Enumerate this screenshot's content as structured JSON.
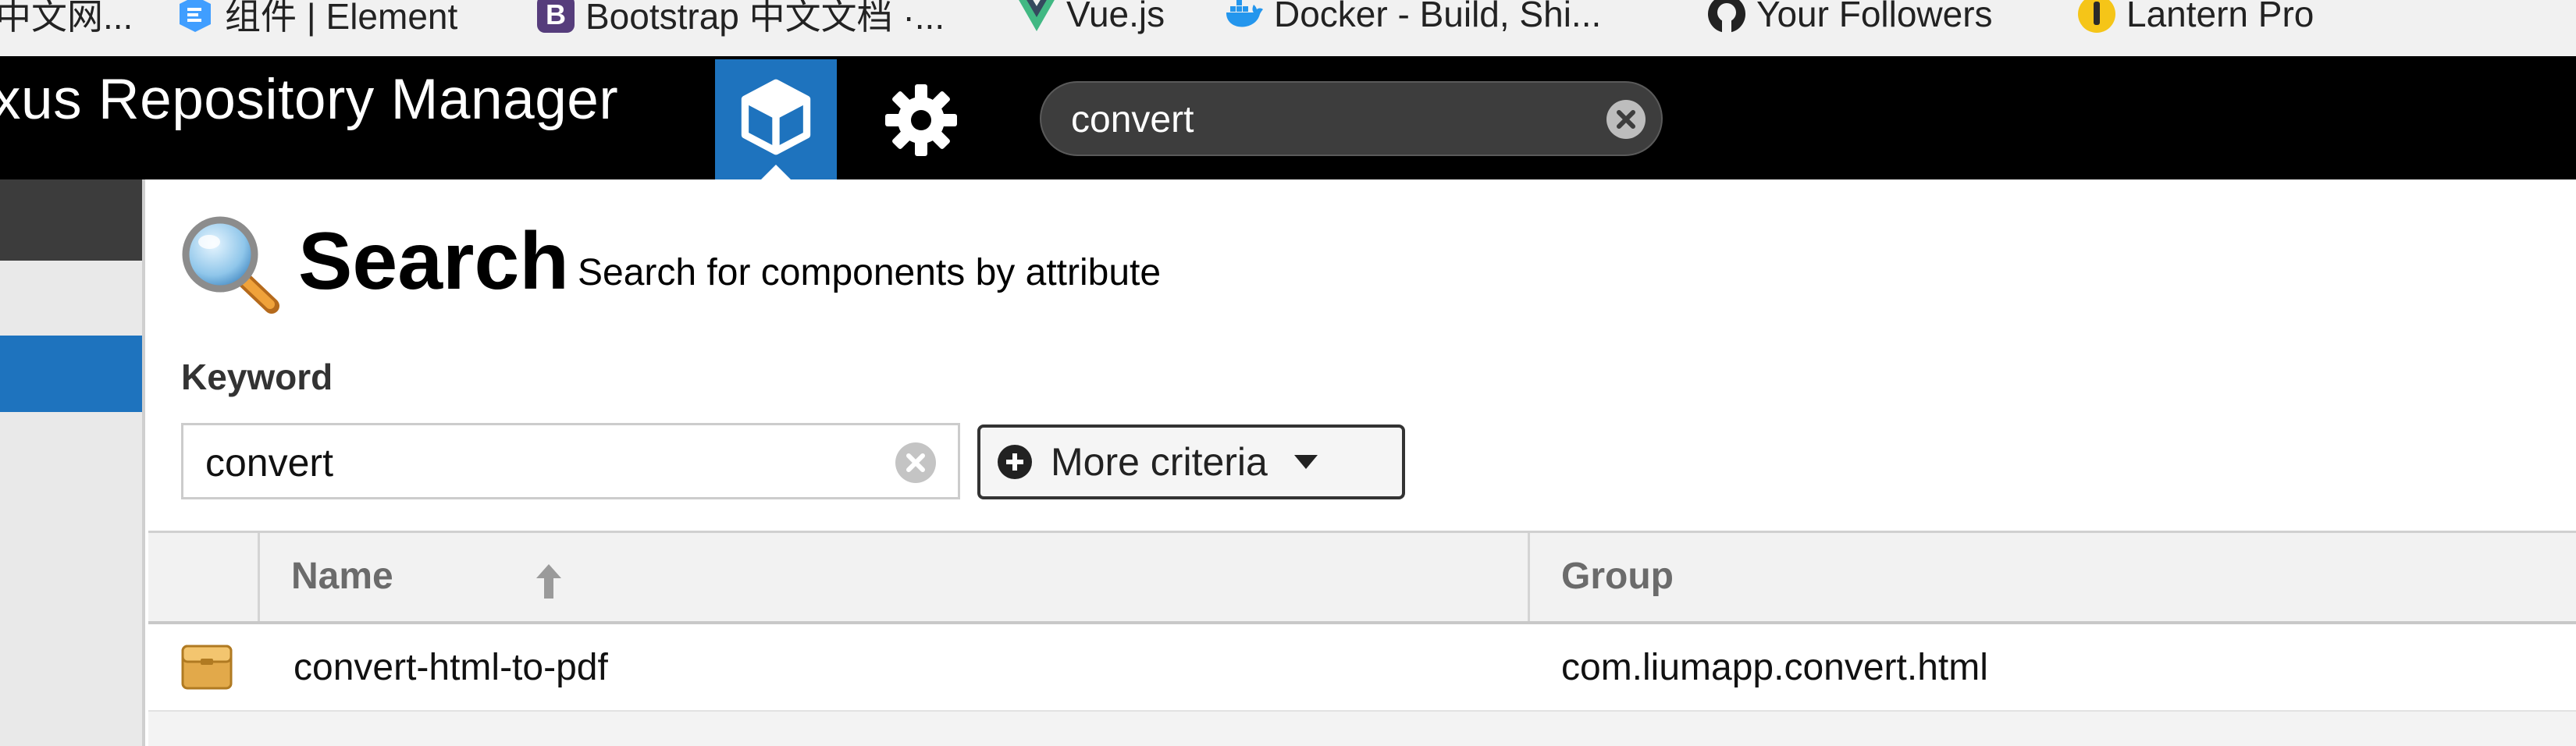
{
  "bookmarks": [
    {
      "label": "中文网...",
      "icon": "site-icon"
    },
    {
      "label": "组件 | Element",
      "icon": "element-icon"
    },
    {
      "label": "Bootstrap 中文文档 ·...",
      "icon": "bootstrap-icon"
    },
    {
      "label": "Vue.js",
      "icon": "vue-icon"
    },
    {
      "label": "Docker - Build, Shi...",
      "icon": "docker-icon"
    },
    {
      "label": "Your Followers",
      "icon": "github-icon"
    },
    {
      "label": "Lantern Pro",
      "icon": "lantern-icon"
    }
  ],
  "header": {
    "app_title": "xus Repository Manager",
    "search_value": "convert"
  },
  "page": {
    "title": "Search",
    "subtitle": "Search for components by attribute"
  },
  "filters": {
    "keyword_label": "Keyword",
    "keyword_value": "convert",
    "more_criteria_label": "More criteria"
  },
  "table": {
    "columns": [
      "Name",
      "Group"
    ],
    "rows": [
      {
        "name": "convert-html-to-pdf",
        "group": "com.liumapp.convert.html"
      }
    ]
  },
  "colors": {
    "accent": "#1e73be",
    "header_bg": "#000000"
  }
}
